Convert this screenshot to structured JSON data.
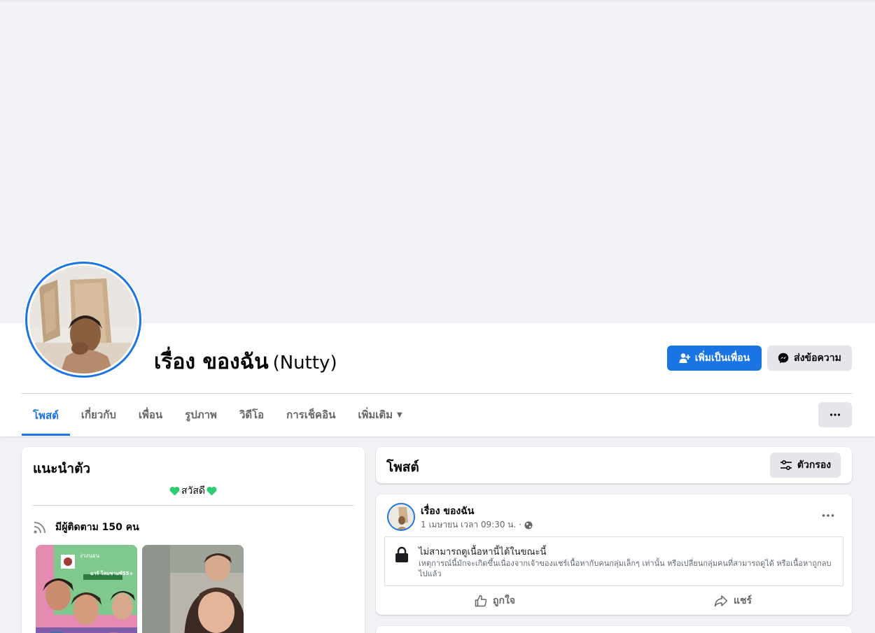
{
  "profile": {
    "name": "เรื่อง ของฉัน",
    "alternate_name": "(Nutty)"
  },
  "actions": {
    "add_friend_label": "เพิ่มเป็นเพื่อน",
    "message_label": "ส่งข้อความ"
  },
  "tabs": [
    {
      "label": "โพสต์",
      "active": true
    },
    {
      "label": "เกี่ยวกับ",
      "active": false
    },
    {
      "label": "เพื่อน",
      "active": false
    },
    {
      "label": "รูปภาพ",
      "active": false
    },
    {
      "label": "วิดีโอ",
      "active": false
    },
    {
      "label": "การเช็คอิน",
      "active": false
    },
    {
      "label": "เพิ่มเติม",
      "active": false
    }
  ],
  "intro": {
    "title": "แนะนำตัว",
    "bio": "สวัสดี",
    "followers_text": "มีผู้ติดตาม 150 คน",
    "thumb1_caption_name": "ง่วงนอน",
    "thumb1_caption_text": "มาร์ โคมชามพ์55+"
  },
  "posts_header": {
    "title": "โพสต์",
    "filter_label": "ตัวกรอง"
  },
  "post": {
    "author": "เรื่อง ของฉัน",
    "timestamp": "1 เมษายน เวลา 09:30 น. ·",
    "notice_title": "ไม่สามารถดูเนื้อหานี้ได้ในขณะนี้",
    "notice_body": "เหตุการณ์นี้มักจะเกิดขึ้นเนื่องจากเจ้าของแชร์เนื้อหากับคนกลุ่มเล็กๆ เท่านั้น หรือเปลี่ยนกลุ่มคนที่สามารถดูได้ หรือเนื้อหาถูกลบไปแล้ว",
    "like_label": "ถูกใจ",
    "share_label": "แชร์"
  },
  "colors": {
    "brand_blue": "#1b74e4",
    "heart_green": "#2ecc71",
    "background": "#f0f2f5"
  }
}
